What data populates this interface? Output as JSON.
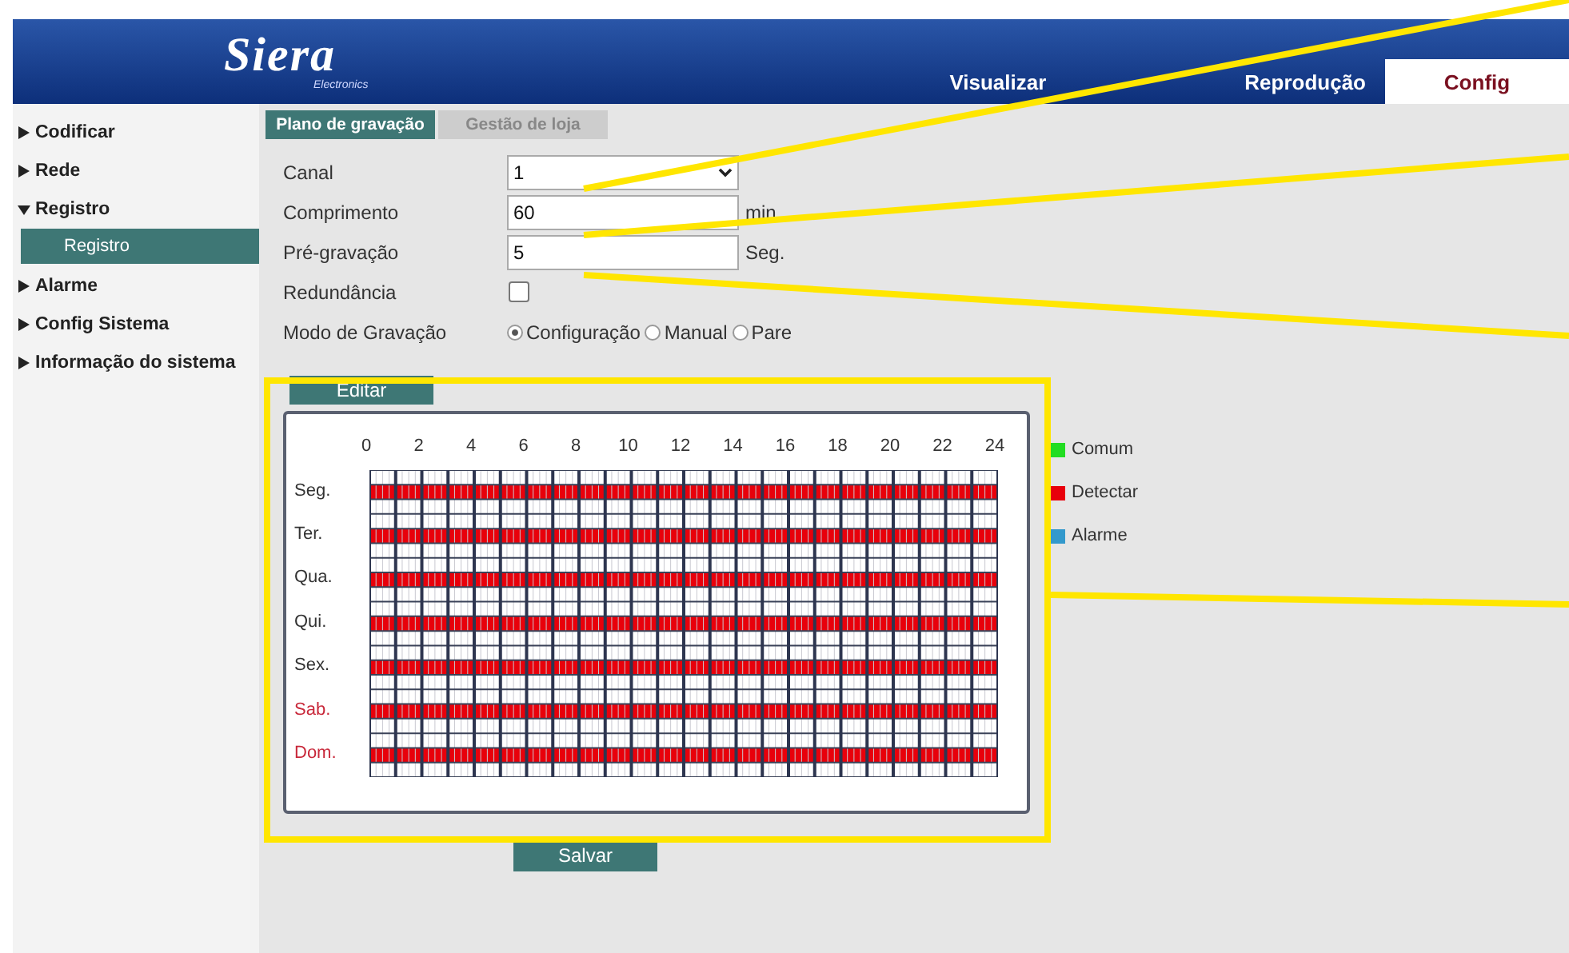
{
  "header": {
    "logo": "Siera",
    "logo_sub": "Electronics",
    "tabs": [
      {
        "label": "Visualizar",
        "selected": false
      },
      {
        "label": "Reprodução",
        "selected": false
      },
      {
        "label": "Config",
        "selected": true
      }
    ]
  },
  "sidebar": {
    "items": [
      {
        "label": "Codificar",
        "expanded": false
      },
      {
        "label": "Rede",
        "expanded": false
      },
      {
        "label": "Registro",
        "expanded": true,
        "children": [
          {
            "label": "Registro",
            "selected": true
          }
        ]
      },
      {
        "label": "Alarme",
        "expanded": false
      },
      {
        "label": "Config Sistema",
        "expanded": false
      },
      {
        "label": "Informação do sistema",
        "expanded": false
      }
    ]
  },
  "tabs": [
    {
      "label": "Plano de gravação",
      "selected": true
    },
    {
      "label": "Gestão de loja",
      "selected": false
    }
  ],
  "form": [
    {
      "kind": "select",
      "label": "Canal",
      "value": "1"
    },
    {
      "kind": "text",
      "label": "Comprimento",
      "value": "60",
      "unit": "min"
    },
    {
      "kind": "text",
      "label": "Pré-gravação",
      "value": "5",
      "unit": "Seg."
    },
    {
      "kind": "checkbox",
      "label": "Redundância",
      "checked": false
    },
    {
      "kind": "radio",
      "label": "Modo de Gravação",
      "options": [
        {
          "label": "Configuração",
          "selected": true
        },
        {
          "label": "Manual",
          "selected": false
        },
        {
          "label": "Pare",
          "selected": false
        }
      ]
    }
  ],
  "edit_button": "Editar",
  "schedule": {
    "hours": [
      "0",
      "2",
      "4",
      "6",
      "8",
      "10",
      "12",
      "14",
      "16",
      "18",
      "20",
      "22",
      "24"
    ],
    "days": [
      {
        "label": "Seg.",
        "weekend": false,
        "color": "#e8000b"
      },
      {
        "label": "Ter.",
        "weekend": false,
        "color": "#e8000b"
      },
      {
        "label": "Qua.",
        "weekend": false,
        "color": "#e8000b"
      },
      {
        "label": "Qui.",
        "weekend": false,
        "color": "#e8000b"
      },
      {
        "label": "Sex.",
        "weekend": false,
        "color": "#e8000b"
      },
      {
        "label": "Sab.",
        "weekend": true,
        "color": "#e8000b"
      },
      {
        "label": "Dom.",
        "weekend": true,
        "color": "#e8000b"
      }
    ]
  },
  "legend": [
    {
      "label": "Comum",
      "color": "#22dd22"
    },
    {
      "label": "Detectar",
      "color": "#e8000b"
    },
    {
      "label": "Alarme",
      "color": "#3399cc"
    }
  ],
  "save_button": "Salvar",
  "callouts": [
    {
      "kind": "line"
    },
    {
      "kind": "line"
    },
    {
      "kind": "line"
    },
    {
      "kind": "frame"
    },
    {
      "kind": "line"
    }
  ]
}
